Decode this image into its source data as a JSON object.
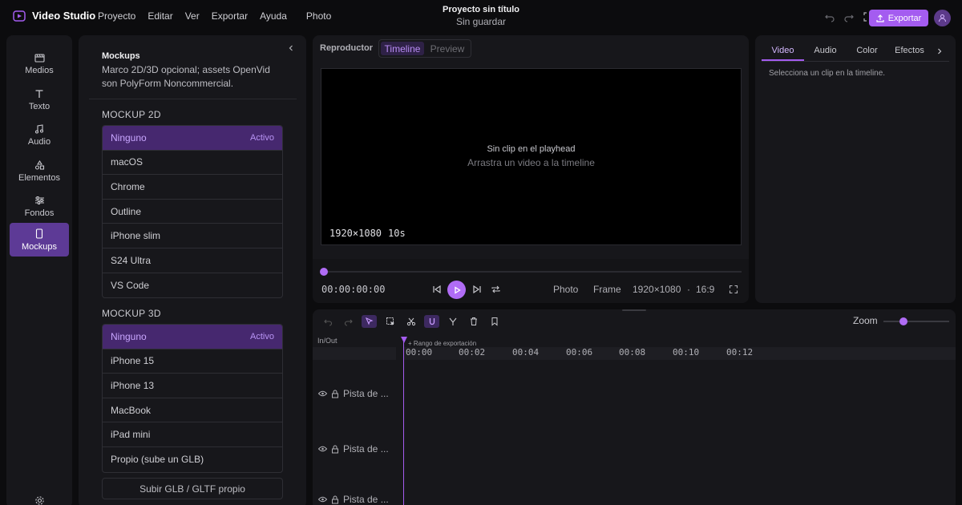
{
  "app": {
    "name": "Video Studio",
    "menu": [
      "Proyecto",
      "Editar",
      "Ver",
      "Exportar",
      "Ayuda"
    ],
    "photo_label": "Photo",
    "project_title": "Proyecto sin título",
    "save_status": "Sin guardar",
    "export_label": "Exportar",
    "accent_color": "#a45cf0"
  },
  "sidebar": {
    "items": [
      {
        "label": "Medios",
        "icon": "media-icon"
      },
      {
        "label": "Texto",
        "icon": "text-icon"
      },
      {
        "label": "Audio",
        "icon": "music-note-icon"
      },
      {
        "label": "Elementos",
        "icon": "shapes-icon"
      },
      {
        "label": "Fondos",
        "icon": "sliders-icon"
      },
      {
        "label": "Mockups",
        "icon": "phone-icon"
      }
    ],
    "active": "Mockups",
    "settings_icon": "gear-icon"
  },
  "mockups": {
    "title": "Mockups",
    "description": "Marco 2D/3D opcional; assets OpenVid son PolyForm Noncommercial.",
    "section_2d": "MOCKUP 2D",
    "options_2d": [
      "Ninguno",
      "macOS",
      "Chrome",
      "Outline",
      "iPhone slim",
      "S24 Ultra",
      "VS Code"
    ],
    "active_2d_badge": "Activo",
    "section_3d": "MOCKUP 3D",
    "options_3d": [
      "Ninguno",
      "iPhone 15",
      "iPhone 13",
      "MacBook",
      "iPad mini",
      "Propio (sube un GLB)"
    ],
    "active_3d_badge": "Activo",
    "upload_label": "Subir GLB / GLTF propio"
  },
  "player": {
    "label": "Reproductor",
    "tabs": [
      "Timeline",
      "Preview"
    ],
    "active_tab": "Timeline",
    "empty_title": "Sin clip en el playhead",
    "empty_hint": "Arrastra un video a la timeline",
    "resolution": "1920×1080",
    "duration": "10s",
    "timecode": "00:00:00:00",
    "photo_btn": "Photo",
    "frame_btn": "Frame",
    "output_res": "1920×1080",
    "dot": "·",
    "aspect": "16:9"
  },
  "inspector": {
    "tabs": [
      "Video",
      "Audio",
      "Color",
      "Efectos"
    ],
    "active_tab": "Video",
    "hint": "Selecciona un clip en la timeline."
  },
  "timeline": {
    "zoom_label": "Zoom",
    "inout_label": "In/Out",
    "range_label": "+ Rango de exportación",
    "ticks": [
      "00:00",
      "00:02",
      "00:04",
      "00:06",
      "00:08",
      "00:10",
      "00:12"
    ],
    "tracks": [
      "Pista de ...",
      "Pista de ...",
      "Pista de ..."
    ]
  }
}
